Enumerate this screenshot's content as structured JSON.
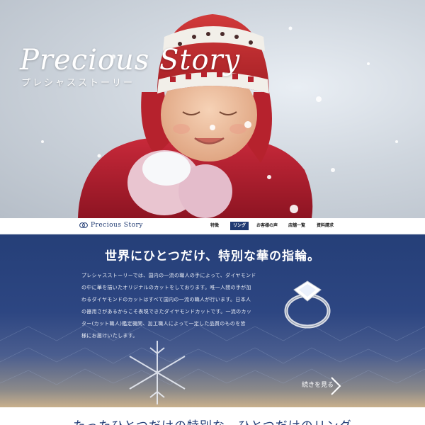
{
  "hero": {
    "title": "Precious Story",
    "subtitle": "プレシャスストーリー"
  },
  "nav": {
    "logo_text": "Precious Story",
    "items": [
      {
        "label": "特徴",
        "active": false
      },
      {
        "label": "リング",
        "active": true
      },
      {
        "label": "お客様の声",
        "active": false
      },
      {
        "label": "店舗一覧",
        "active": false
      },
      {
        "label": "資料請求",
        "active": false
      }
    ]
  },
  "main": {
    "title": "世界にひとつだけ、特別な華の指輪。",
    "body_lines": [
      "プレシャスストーリーでは、国内の一流の職人の手によって、ダイヤモンド",
      "の中に華を描いたオリジナルのカットをしております。唯一人間の手が加",
      "わるダイヤモンドのカットはすべて国内の一流の職人が行います。日本人",
      "の器用さがあるからこそ表現できたダイヤモンドカットです。一流のカッ",
      "ター(カット職人)鑑定機関、加工職人によって一定した品質のものを皆",
      "様にお届けいたします。"
    ],
    "read_more": "続きを見る"
  },
  "bottom": {
    "title": "たったひとつだけの特別な、ひとつだけのリング"
  },
  "colors": {
    "brand_navy": "#1f3a72",
    "section_blue": "#253f78"
  }
}
